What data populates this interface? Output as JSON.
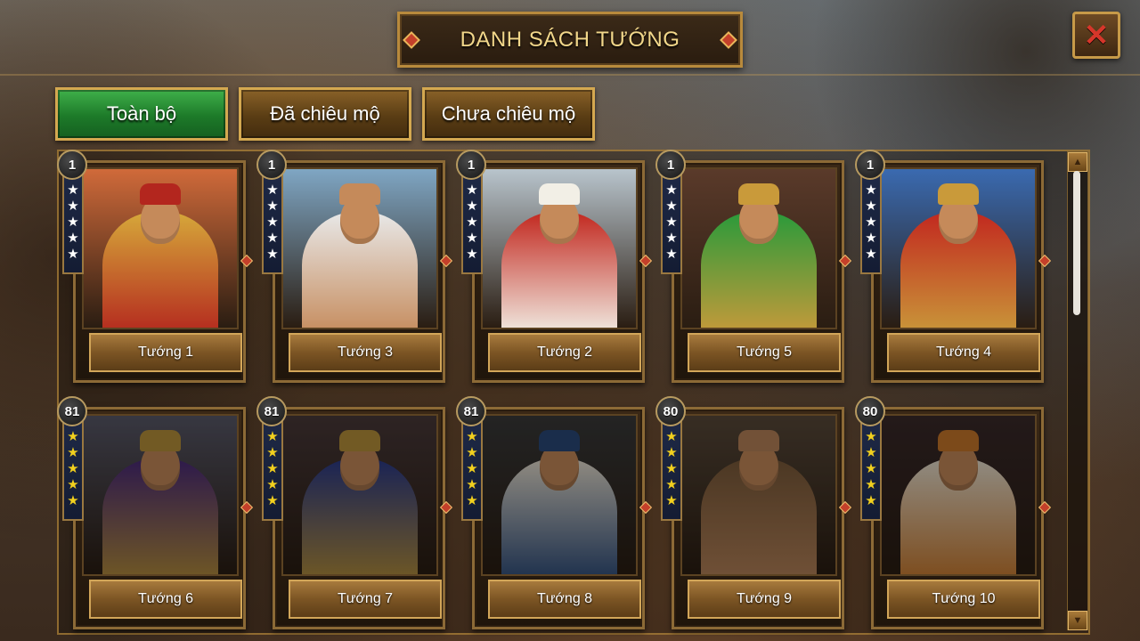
{
  "title": "DANH SÁCH TƯỚNG",
  "close_icon": "close-x-icon",
  "tabs": [
    {
      "label": "Toàn bộ",
      "active": true
    },
    {
      "label": "Đã chiêu mộ",
      "active": false
    },
    {
      "label": "Chưa chiêu mộ",
      "active": false
    }
  ],
  "colors": {
    "active_tab": "#1d7a29",
    "inactive_tab": "#5a3d14",
    "gold_border": "#d4a850",
    "star_white": "#ffffff",
    "star_yellow": "#f2d01e"
  },
  "generals": [
    {
      "name": "Tướng 1",
      "level": "1",
      "stars": 5,
      "star_color": "white",
      "palette": [
        "#d06a3a",
        "#b3261e",
        "#d6a83a"
      ],
      "recruited": true
    },
    {
      "name": "Tướng 3",
      "level": "1",
      "stars": 5,
      "star_color": "white",
      "palette": [
        "#7fa6c4",
        "#c58a5a",
        "#e8e8e8"
      ],
      "recruited": true
    },
    {
      "name": "Tướng 2",
      "level": "1",
      "stars": 5,
      "star_color": "white",
      "palette": [
        "#b8c4cc",
        "#f2efe6",
        "#c2281f"
      ],
      "recruited": true
    },
    {
      "name": "Tướng 5",
      "level": "1",
      "stars": 5,
      "star_color": "white",
      "palette": [
        "#5a3a2a",
        "#c99a3a",
        "#2a9a3a"
      ],
      "recruited": true
    },
    {
      "name": "Tướng 4",
      "level": "1",
      "stars": 5,
      "star_color": "white",
      "palette": [
        "#3a6ab0",
        "#c99a3a",
        "#c2281f"
      ],
      "recruited": true
    },
    {
      "name": "Tướng 6",
      "level": "81",
      "stars": 5,
      "star_color": "yellow",
      "palette": [
        "#5a5a6a",
        "#b8913a",
        "#4a2a7a"
      ],
      "recruited": false
    },
    {
      "name": "Tướng 7",
      "level": "81",
      "stars": 5,
      "star_color": "yellow",
      "palette": [
        "#4a3a3a",
        "#b8913a",
        "#2a3a8a"
      ],
      "recruited": false
    },
    {
      "name": "Tướng 8",
      "level": "81",
      "stars": 5,
      "star_color": "yellow",
      "palette": [
        "#3a3a3a",
        "#2a4a7a",
        "#e8e0d0"
      ],
      "recruited": false
    },
    {
      "name": "Tướng 9",
      "level": "80",
      "stars": 5,
      "star_color": "yellow",
      "palette": [
        "#5a4a3a",
        "#b8845a",
        "#7a5a3a"
      ],
      "recruited": false
    },
    {
      "name": "Tướng 10",
      "level": "80",
      "stars": 5,
      "star_color": "yellow",
      "palette": [
        "#3a2a2a",
        "#c9782a",
        "#e8e0d0"
      ],
      "recruited": false
    }
  ],
  "scrollbar": {
    "up_icon": "arrow-up-icon",
    "down_icon": "arrow-down-icon",
    "position": 0.0
  }
}
